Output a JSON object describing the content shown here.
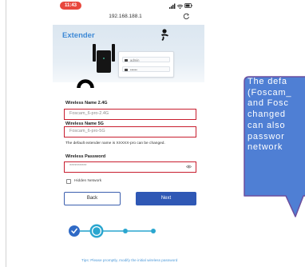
{
  "status_bar": {
    "time": "11:43",
    "icons": [
      "signal-icon",
      "wifi-icon",
      "battery-icon"
    ]
  },
  "browser": {
    "url": "192.168.188.1",
    "refresh_icon": "refresh-icon"
  },
  "hero": {
    "title": "Extender",
    "login_card": {
      "username": "admin",
      "password": "••••••"
    },
    "icons": [
      "antenna-icon",
      "wifi-arc-icon",
      "user-icon",
      "lock-icon"
    ]
  },
  "form": {
    "name_24g": {
      "label": "Wireless Name 2.4G",
      "value": "Foscam_6-pro-2.4G"
    },
    "name_5g": {
      "label": "Wireless Name 5G",
      "value": "Foscam_6-pro-5G"
    },
    "hint": "The default extender name is XXXXX-pro can be changed.",
    "password": {
      "label": "Wireless Password",
      "value": "**********",
      "icon": "show-password-icon"
    },
    "hidden_network": {
      "label": "Hidden Network",
      "checked": false
    },
    "back_label": "Back",
    "next_label": "Next"
  },
  "steps": {
    "states": [
      "done",
      "current",
      "pending",
      "pending"
    ]
  },
  "tip": "Tips: Please promptly, modify the initial wireless password",
  "callout": {
    "lines": [
      "The defa",
      "(Foscam_",
      "and Fosc",
      "changed",
      "can also",
      "passwor",
      "network"
    ]
  },
  "colors": {
    "status_pill": "#e8473d",
    "brand_blue": "#3f8ad6",
    "highlight_border": "#c81e2f",
    "primary_button": "#2f58b5",
    "step_done": "#2f6ac6",
    "step_active": "#2aa6cf",
    "tip_text": "#4e9ad9",
    "callout_fill": "#4f7fd4",
    "callout_border": "#6c4f9e"
  }
}
